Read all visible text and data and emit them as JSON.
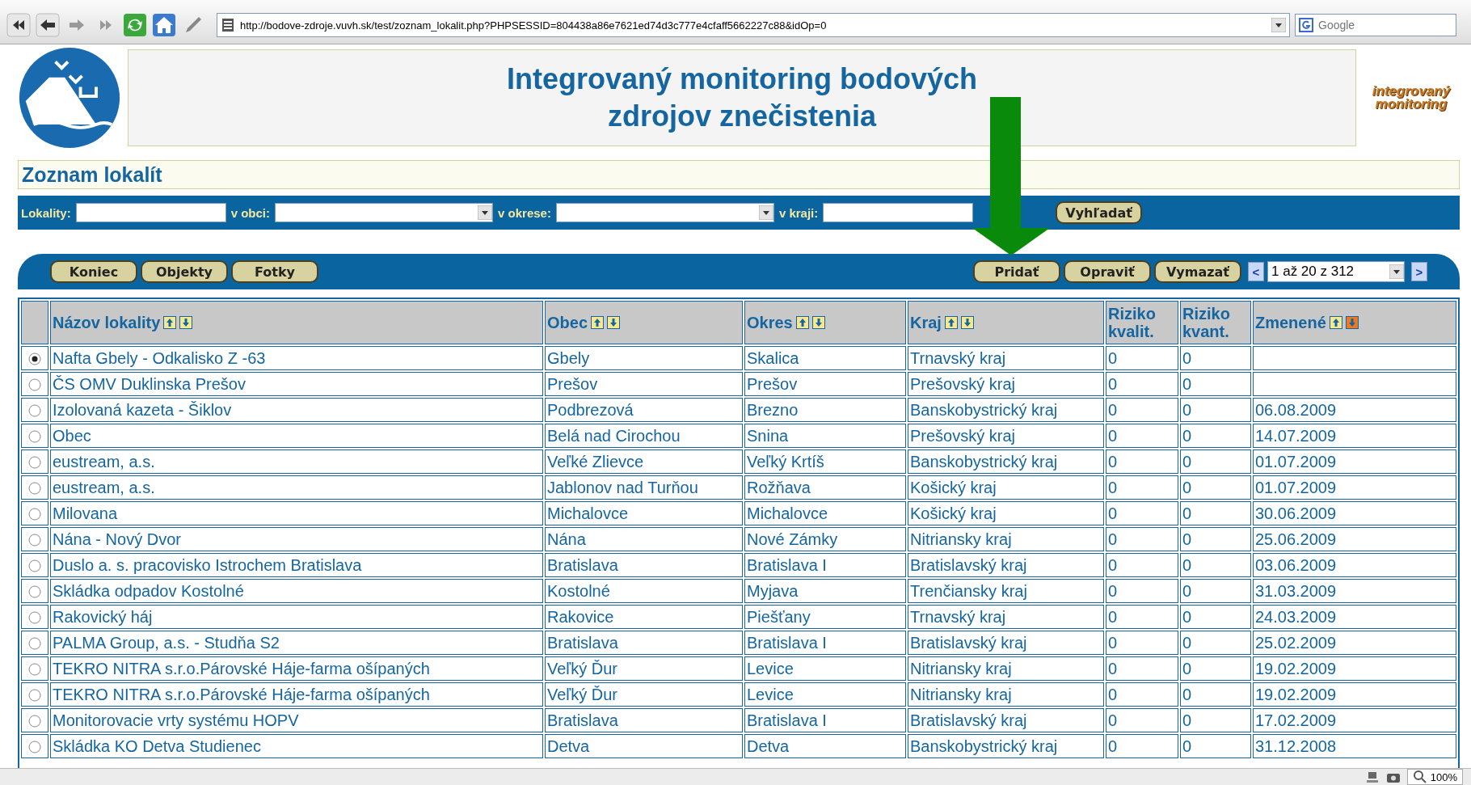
{
  "browser": {
    "url": "http://bodove-zdroje.vuvh.sk/test/zoznam_lokalit.php?PHPSESSID=804438a86e7621ed74d3c777e4cfaff5662227c88&idOp=0",
    "search_placeholder": "Google"
  },
  "header": {
    "title": "Integrovaný monitoring bodových zdrojov znečistenia",
    "logo_text": [
      "integrovaný",
      "monitoring"
    ]
  },
  "page_title": "Zoznam lokalít",
  "filters": [
    {
      "label": "Lokality:",
      "kind": "text"
    },
    {
      "label": "v obci:",
      "kind": "select"
    },
    {
      "label": "v okrese:",
      "kind": "select"
    },
    {
      "label": "v kraji:",
      "kind": "text"
    }
  ],
  "search_button": "Vyhľadať",
  "left_buttons": [
    "Koniec",
    "Objekty",
    "Fotky"
  ],
  "right_buttons": [
    "Pridať",
    "Opraviť",
    "Vymazať"
  ],
  "pager": {
    "prev": "<",
    "value": "1 až 20 z 312",
    "next": ">"
  },
  "columns": [
    {
      "label": "Názov lokality",
      "sortable": true,
      "sorted_desc": false
    },
    {
      "label": "Obec",
      "sortable": true,
      "sorted_desc": false
    },
    {
      "label": "Okres",
      "sortable": true,
      "sorted_desc": false
    },
    {
      "label": "Kraj",
      "sortable": true,
      "sorted_desc": false
    },
    {
      "label": "Riziko kvalit.",
      "sortable": false
    },
    {
      "label": "Riziko kvant.",
      "sortable": false
    },
    {
      "label": "Zmenené",
      "sortable": true,
      "sorted_desc": true
    }
  ],
  "rows": [
    {
      "selected": true,
      "cells": [
        "Nafta Gbely - Odkalisko Z -63",
        "Gbely",
        "Skalica",
        "Trnavský kraj",
        "0",
        "0"
      ]
    },
    {
      "selected": false,
      "cells": [
        "ČS OMV Duklinska Prešov",
        "Prešov",
        "Prešov",
        "Prešovský kraj",
        "0",
        "0"
      ]
    },
    {
      "selected": false,
      "cells": [
        "Izolovaná kazeta - Šiklov",
        "Podbrezová",
        "Brezno",
        "Banskobystrický kraj",
        "0",
        "0",
        "06.08.2009"
      ]
    },
    {
      "selected": false,
      "cells": [
        "Obec",
        "Belá nad Cirochou",
        "Snina",
        "Prešovský kraj",
        "0",
        "0",
        "14.07.2009"
      ]
    },
    {
      "selected": false,
      "cells": [
        "eustream, a.s.",
        "Veľké Zlievce",
        "Veľký Krtíš",
        "Banskobystrický kraj",
        "0",
        "0",
        "01.07.2009"
      ]
    },
    {
      "selected": false,
      "cells": [
        "eustream, a.s.",
        "Jablonov nad Turňou",
        "Rožňava",
        "Košický kraj",
        "0",
        "0",
        "01.07.2009"
      ]
    },
    {
      "selected": false,
      "cells": [
        "Milovana",
        "Michalovce",
        "Michalovce",
        "Košický kraj",
        "0",
        "0",
        "30.06.2009"
      ]
    },
    {
      "selected": false,
      "cells": [
        "Nána - Nový Dvor",
        "Nána",
        "Nové Zámky",
        "Nitriansky kraj",
        "0",
        "0",
        "25.06.2009"
      ]
    },
    {
      "selected": false,
      "cells": [
        "Duslo a. s. pracovisko Istrochem Bratislava",
        "Bratislava",
        "Bratislava I",
        "Bratislavský kraj",
        "0",
        "0",
        "03.06.2009"
      ]
    },
    {
      "selected": false,
      "cells": [
        "Skládka odpadov Kostolné",
        "Kostolné",
        "Myjava",
        "Trenčiansky kraj",
        "0",
        "0",
        "31.03.2009"
      ]
    },
    {
      "selected": false,
      "cells": [
        "Rakovický háj",
        "Rakovice",
        "Piešťany",
        "Trnavský kraj",
        "0",
        "0",
        "24.03.2009"
      ]
    },
    {
      "selected": false,
      "cells": [
        "PALMA Group, a.s. - Studňa S2",
        "Bratislava",
        "Bratislava I",
        "Bratislavský kraj",
        "0",
        "0",
        "25.02.2009"
      ]
    },
    {
      "selected": false,
      "cells": [
        "TEKRO NITRA s.r.o.Párovské Háje-farma ošípaných",
        "Veľký Ďur",
        "Levice",
        "Nitriansky kraj",
        "0",
        "0",
        "19.02.2009"
      ]
    },
    {
      "selected": false,
      "cells": [
        "TEKRO NITRA s.r.o.Párovské Háje-farma ošípaných",
        "Veľký Ďur",
        "Levice",
        "Nitriansky kraj",
        "0",
        "0",
        "19.02.2009"
      ]
    },
    {
      "selected": false,
      "cells": [
        "Monitorovacie vrty systému HOPV",
        "Bratislava",
        "Bratislava I",
        "Bratislavský kraj",
        "0",
        "0",
        "17.02.2009"
      ]
    },
    {
      "selected": false,
      "cells": [
        "Skládka KO Detva Studienec",
        "Detva",
        "Detva",
        "Banskobystrický kraj",
        "0",
        "0",
        "31.12.2008"
      ]
    }
  ],
  "status_bar": {
    "zoom": "100%"
  }
}
